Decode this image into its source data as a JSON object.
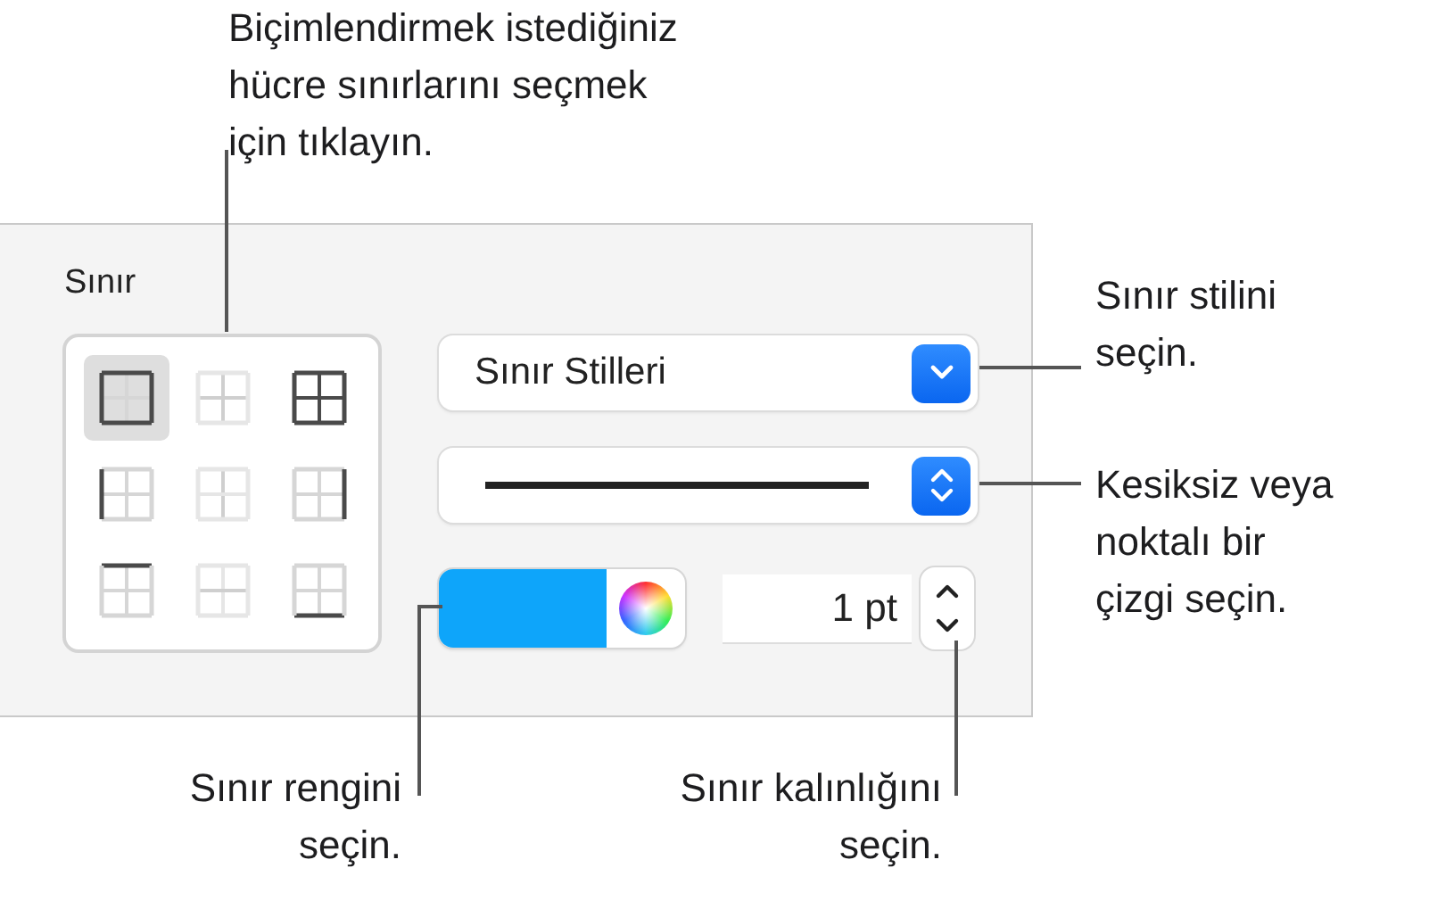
{
  "callouts": [
    {
      "lines": [
        "Biçimlendirmek istediğiniz",
        "hücre sınırlarını seçmek",
        "için tıklayın."
      ]
    },
    {
      "lines": [
        "Sınır stilini",
        "seçin."
      ]
    },
    {
      "lines": [
        "Kesiksiz veya",
        "noktalı bir",
        "çizgi seçin."
      ]
    },
    {
      "lines": [
        "Sınır rengini",
        "seçin."
      ]
    },
    {
      "lines": [
        "Sınır kalınlığını",
        "seçin."
      ]
    }
  ],
  "panel": {
    "title": "Sınır",
    "border_buttons": [
      {
        "kind": "outer",
        "selected": true
      },
      {
        "kind": "inner",
        "selected": false
      },
      {
        "kind": "all",
        "selected": false
      },
      {
        "kind": "left",
        "selected": false
      },
      {
        "kind": "inner-vertical",
        "selected": false
      },
      {
        "kind": "right",
        "selected": false
      },
      {
        "kind": "top",
        "selected": false
      },
      {
        "kind": "inner-horizontal",
        "selected": false
      },
      {
        "kind": "bottom",
        "selected": false
      }
    ],
    "style_menu": {
      "value": "Sınır Stilleri"
    },
    "line_style": {
      "kind": "solid"
    },
    "color_well": {
      "color": "#0ea5fa"
    },
    "width_field": {
      "value": "1 pt"
    }
  }
}
